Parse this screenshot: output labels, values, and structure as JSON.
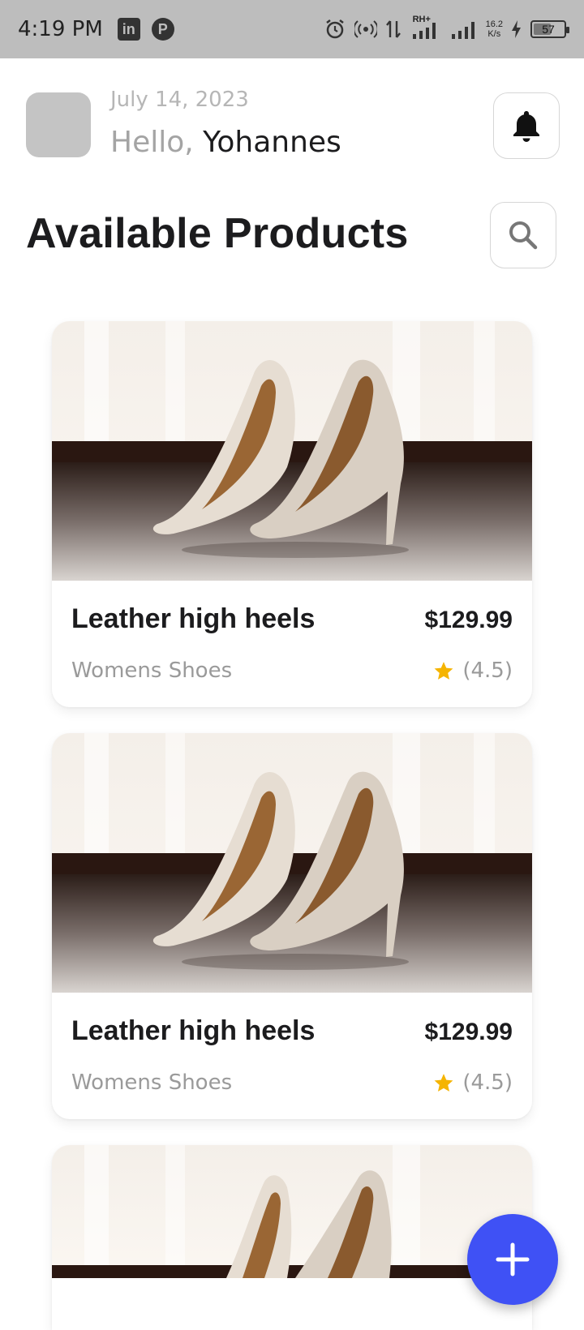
{
  "status_bar": {
    "time": "4:19 PM",
    "app_icons": [
      "linkedin-icon",
      "app-icon"
    ],
    "net_speed_value": "16.2",
    "net_speed_unit": "K/s",
    "network_label": "RH+",
    "battery_level": "57"
  },
  "header": {
    "date": "July 14, 2023",
    "greeting_prefix": "Hello,",
    "user_name": "Yohannes"
  },
  "page": {
    "title": "Available Products"
  },
  "products": [
    {
      "name": "Leather high heels",
      "price": "$129.99",
      "category": "Womens Shoes",
      "rating": "(4.5)"
    },
    {
      "name": "Leather high heels",
      "price": "$129.99",
      "category": "Womens Shoes",
      "rating": "(4.5)"
    },
    {
      "name": "",
      "price": "",
      "category": "",
      "rating": ""
    }
  ],
  "colors": {
    "accent": "#3f51f5",
    "star": "#f5b400",
    "status_bar": "#bdbdbd"
  }
}
